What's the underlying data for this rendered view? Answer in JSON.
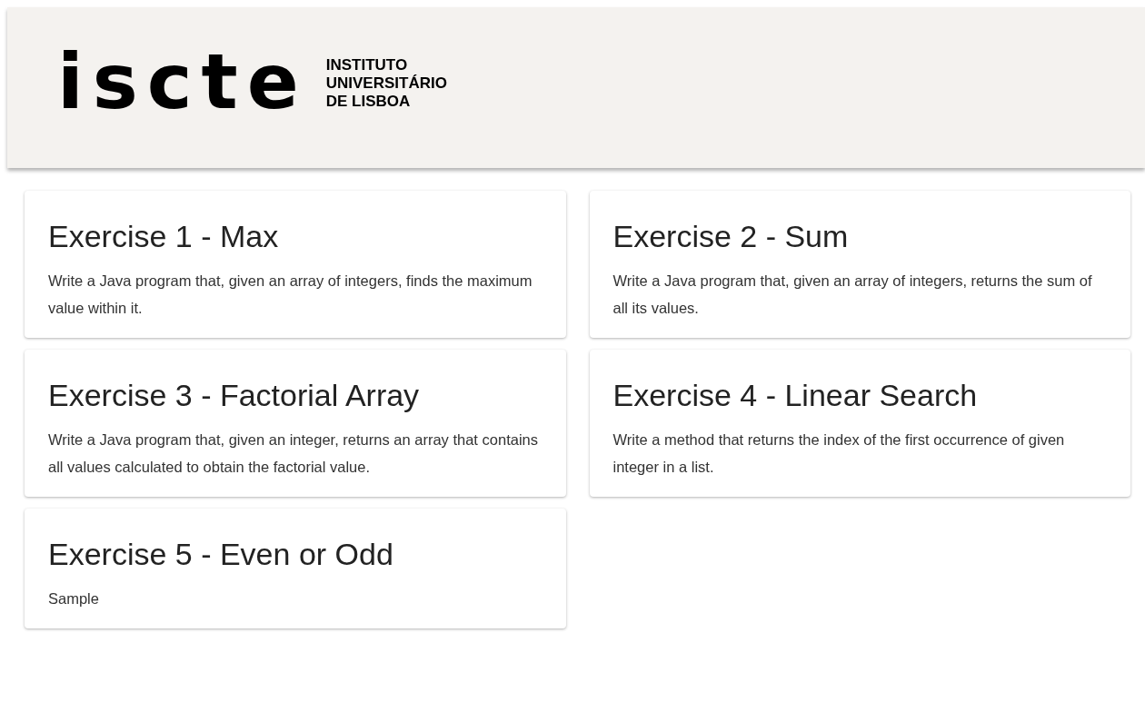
{
  "header": {
    "logo": "iscte",
    "institution": [
      "INSTITUTO",
      "UNIVERSITÁRIO",
      "DE LISBOA"
    ]
  },
  "exercises": [
    {
      "title": "Exercise 1 - Max",
      "description": "Write a Java program that, given an array of integers, finds the maximum value within it."
    },
    {
      "title": "Exercise 2 - Sum",
      "description": "Write a Java program that, given an array of integers, returns the sum of all its values."
    },
    {
      "title": "Exercise 3 - Factorial Array",
      "description": "Write a Java program that, given an integer, returns an array that contains all values calculated to obtain the factorial value."
    },
    {
      "title": "Exercise 4 - Linear Search",
      "description": "Write a method that returns the index of the first occurrence of given integer in a list."
    },
    {
      "title": "Exercise 5 - Even or Odd",
      "description": "Sample"
    }
  ]
}
